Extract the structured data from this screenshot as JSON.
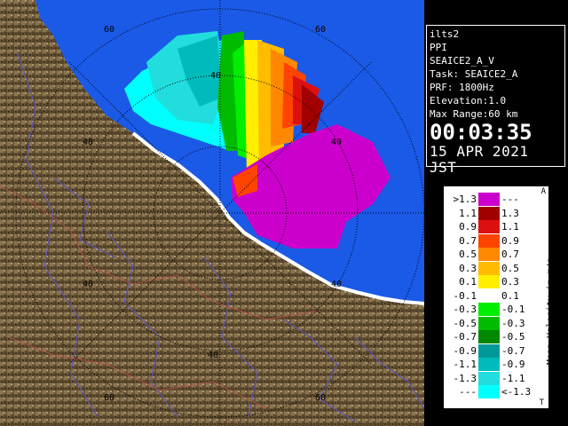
{
  "info": {
    "radar": "ilts2",
    "mode": "PPI",
    "scan": "SEAICE2_A_V",
    "task": "Task: SEAICE2_A",
    "prf": "PRF: 1800Hz",
    "elevation": "Elevation:1.0",
    "max_range": "Max Range:60 km",
    "time": "00:03:35",
    "date": "15 APR 2021 JST"
  },
  "ring_labels": {
    "top_60": "60",
    "top_60b": "60",
    "mid_40a": "40",
    "mid_40b": "40",
    "mid_40c": "40",
    "mid_40d": "40",
    "bot_40": "40",
    "bot_60a": "60",
    "bot_60b": "60"
  },
  "legend": {
    "title": "Mean Velocity in m/s",
    "corner_top": "A",
    "corner_bottom": "T",
    "rows": [
      {
        "lo": ">1.3",
        "hi": "---",
        "color": "#cc00cc"
      },
      {
        "lo": "1.1",
        "hi": "1.3",
        "color": "#a00000"
      },
      {
        "lo": "0.9",
        "hi": "1.1",
        "color": "#dd1010"
      },
      {
        "lo": "0.7",
        "hi": "0.9",
        "color": "#ff4400"
      },
      {
        "lo": "0.5",
        "hi": "0.7",
        "color": "#ff8800"
      },
      {
        "lo": "0.3",
        "hi": "0.5",
        "color": "#ffbb00"
      },
      {
        "lo": "0.1",
        "hi": "0.3",
        "color": "#ffee00"
      },
      {
        "lo": "-0.1",
        "hi": "0.1",
        "color": "#ffffff"
      },
      {
        "lo": "-0.3",
        "hi": "-0.1",
        "color": "#00ee00"
      },
      {
        "lo": "-0.5",
        "hi": "-0.3",
        "color": "#00bb00"
      },
      {
        "lo": "-0.7",
        "hi": "-0.5",
        "color": "#008800"
      },
      {
        "lo": "-0.9",
        "hi": "-0.7",
        "color": "#009999"
      },
      {
        "lo": "-1.1",
        "hi": "-0.9",
        "color": "#00bbbb"
      },
      {
        "lo": "-1.3",
        "hi": "-1.1",
        "color": "#22dddd"
      },
      {
        "lo": "---",
        "hi": "<-1.3",
        "color": "#00ffff"
      }
    ]
  },
  "colors": {
    "sea": "#1a5ae6",
    "land": "#6e5a3a",
    "grid": "#000000"
  }
}
